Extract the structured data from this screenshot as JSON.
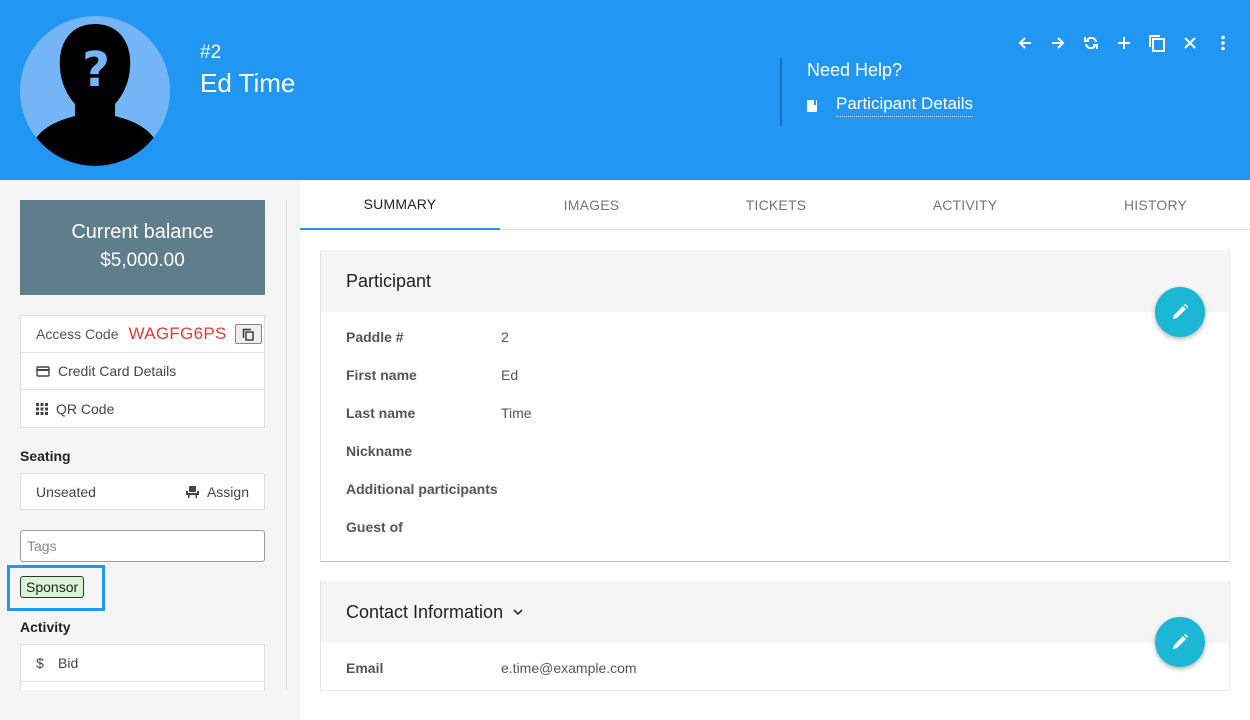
{
  "header": {
    "participant_number": "#2",
    "participant_name": "Ed Time",
    "help": {
      "title": "Need Help?",
      "link_label": "Participant Details"
    },
    "toolbar_icons": [
      "arrow-left-icon",
      "arrow-right-icon",
      "refresh-icon",
      "plus-icon",
      "copy-icon",
      "close-icon",
      "more-vert-icon"
    ]
  },
  "sidebar": {
    "balance_label": "Current balance",
    "balance_value": "$5,000.00",
    "access_code_label": "Access Code",
    "access_code_value": "WAGFG6PS",
    "credit_card_label": "Credit Card Details",
    "qr_code_label": "QR Code",
    "seating_title": "Seating",
    "seating_status": "Unseated",
    "assign_label": "Assign",
    "tags_placeholder": "Tags",
    "tags": [
      "Sponsor"
    ],
    "activity_title": "Activity",
    "activity_items": [
      "Bid"
    ]
  },
  "tabs": [
    "SUMMARY",
    "IMAGES",
    "TICKETS",
    "ACTIVITY",
    "HISTORY"
  ],
  "participant": {
    "title": "Participant",
    "fields": [
      {
        "label": "Paddle #",
        "value": "2"
      },
      {
        "label": "First name",
        "value": "Ed"
      },
      {
        "label": "Last name",
        "value": "Time"
      },
      {
        "label": "Nickname",
        "value": ""
      },
      {
        "label": "Additional participants",
        "value": ""
      },
      {
        "label": "Guest of",
        "value": ""
      }
    ]
  },
  "contact": {
    "title": "Contact Information",
    "fields": [
      {
        "label": "Email",
        "value": "e.time@example.com"
      }
    ]
  },
  "colors": {
    "header": "#2196f3",
    "balance": "#607d8b",
    "access_code": "#e53935",
    "fab": "#1bb7d5",
    "tag_bg": "#d9f5d4"
  }
}
